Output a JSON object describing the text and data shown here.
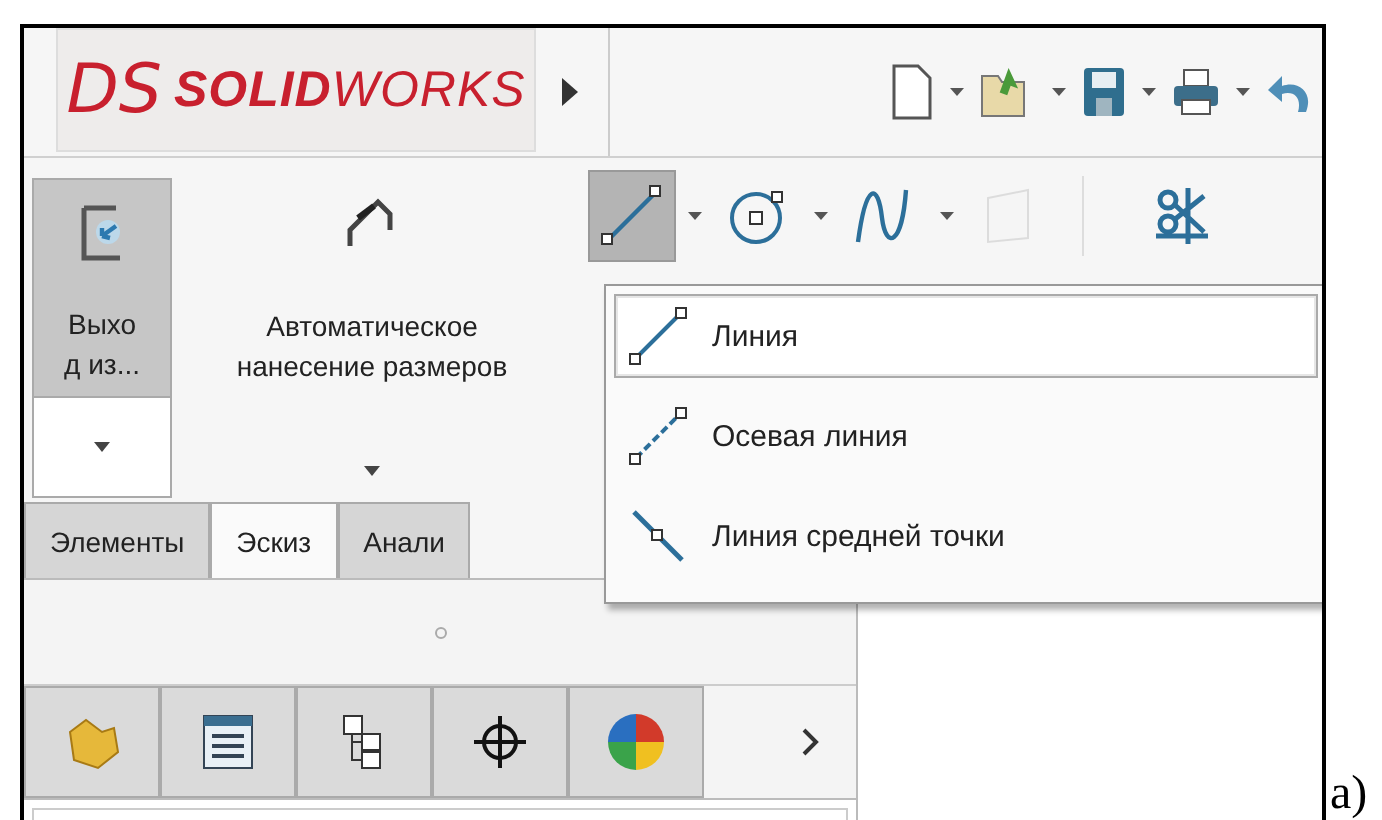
{
  "logo": {
    "mark": "DS",
    "text": "**SOLID**WORKS"
  },
  "ribbon": {
    "exit_sketch": {
      "label_lines": [
        "Выхо",
        "д из..."
      ]
    },
    "auto_dimension": {
      "label": "Автоматическое нанесение размеров"
    },
    "sketch_tools": [
      {
        "kind": "line",
        "selected": true,
        "disabled": false,
        "dropdown": true
      },
      {
        "kind": "circle",
        "selected": false,
        "disabled": false,
        "dropdown": true
      },
      {
        "kind": "spline",
        "selected": false,
        "disabled": false,
        "dropdown": true
      },
      {
        "kind": "rectangle",
        "selected": false,
        "disabled": true,
        "dropdown": false
      }
    ]
  },
  "line_menu": [
    {
      "kind": "line",
      "label": "Линия",
      "selected": true
    },
    {
      "kind": "centerline",
      "label": "Осевая линия",
      "selected": false
    },
    {
      "kind": "midpoint",
      "label": "Линия средней точки",
      "selected": false
    }
  ],
  "tabs": [
    {
      "label": "Элементы",
      "selected": false
    },
    {
      "label": "Эскиз",
      "selected": true
    },
    {
      "label": "Анали",
      "selected": false
    }
  ],
  "caption": "a)"
}
